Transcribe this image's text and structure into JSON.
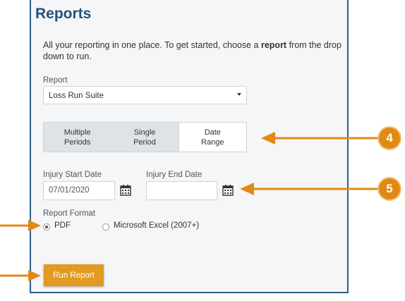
{
  "page": {
    "title": "Reports",
    "intro_before": "All your reporting in one place. To get started, choose a ",
    "intro_bold": "report",
    "intro_after": " from the drop down to run."
  },
  "report": {
    "label": "Report",
    "selected": "Loss Run Suite"
  },
  "tabs": [
    {
      "line1": "Multiple",
      "line2": "Periods"
    },
    {
      "line1": "Single",
      "line2": "Period"
    },
    {
      "line1": "Date",
      "line2": "Range"
    }
  ],
  "dates": {
    "start_label": "Injury Start Date",
    "start_value": "07/01/2020",
    "end_label": "Injury End Date",
    "end_value": ""
  },
  "format": {
    "label": "Report Format",
    "options": [
      "PDF",
      "Microsoft Excel (2007+)"
    ],
    "selected": "PDF"
  },
  "actions": {
    "run_label": "Run Report"
  },
  "callouts": {
    "step4": "4",
    "step5": "5",
    "color": "#e08a14"
  },
  "colors": {
    "accent": "#e29a22",
    "title": "#23537c",
    "border": "#2d5f86"
  }
}
